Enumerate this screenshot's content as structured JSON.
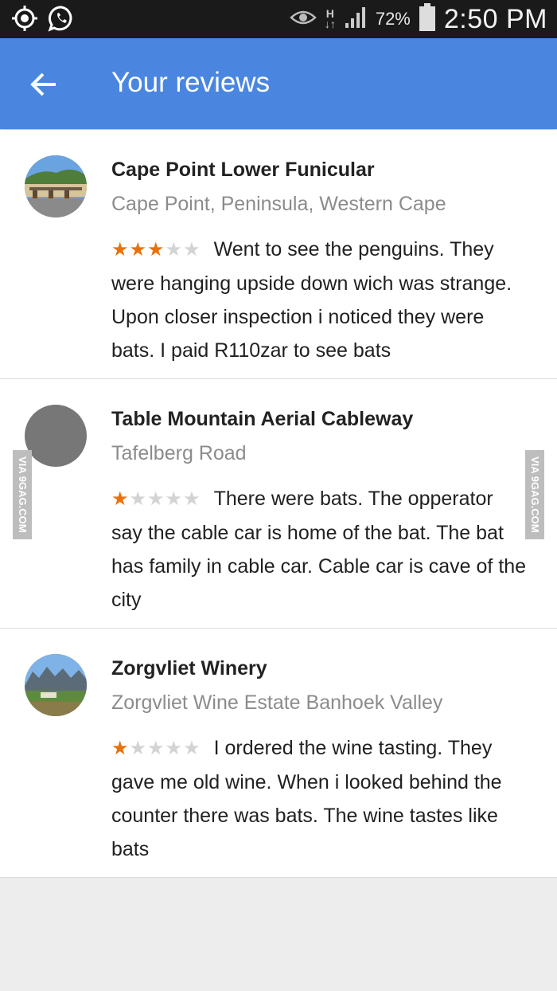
{
  "status_bar": {
    "icons": [
      "gps-icon",
      "whatsapp-icon",
      "eye-icon",
      "h-data-icon",
      "signal-icon",
      "battery-icon"
    ],
    "h_label": "H",
    "battery": "72%",
    "time": "2:50 PM"
  },
  "app_bar": {
    "title": "Your reviews",
    "color": "#4a86e0"
  },
  "reviews": [
    {
      "name": "Cape Point Lower Funicular",
      "address": "Cape Point, Peninsula, Western Cape",
      "rating": 3,
      "text": "Went to see the penguins. They were hanging upside down wich was strange. Upon closer inspection i noticed they were bats. I paid R110zar to see bats"
    },
    {
      "name": "Table Mountain Aerial Cableway",
      "address": "Tafelberg Road",
      "rating": 1,
      "text": "There were bats. The opperator say the cable car is home of the bat. The bat has family in cable car. Cable car is cave of the city"
    },
    {
      "name": "Zorgvliet Winery",
      "address": "Zorgvliet Wine Estate Banhoek Valley",
      "rating": 1,
      "text": "I ordered the wine tasting. They gave me old wine. When i looked behind the counter there was bats. The wine tastes like bats"
    }
  ],
  "watermark": "VIA 9GAG.COM",
  "star_color": "#e8710a"
}
